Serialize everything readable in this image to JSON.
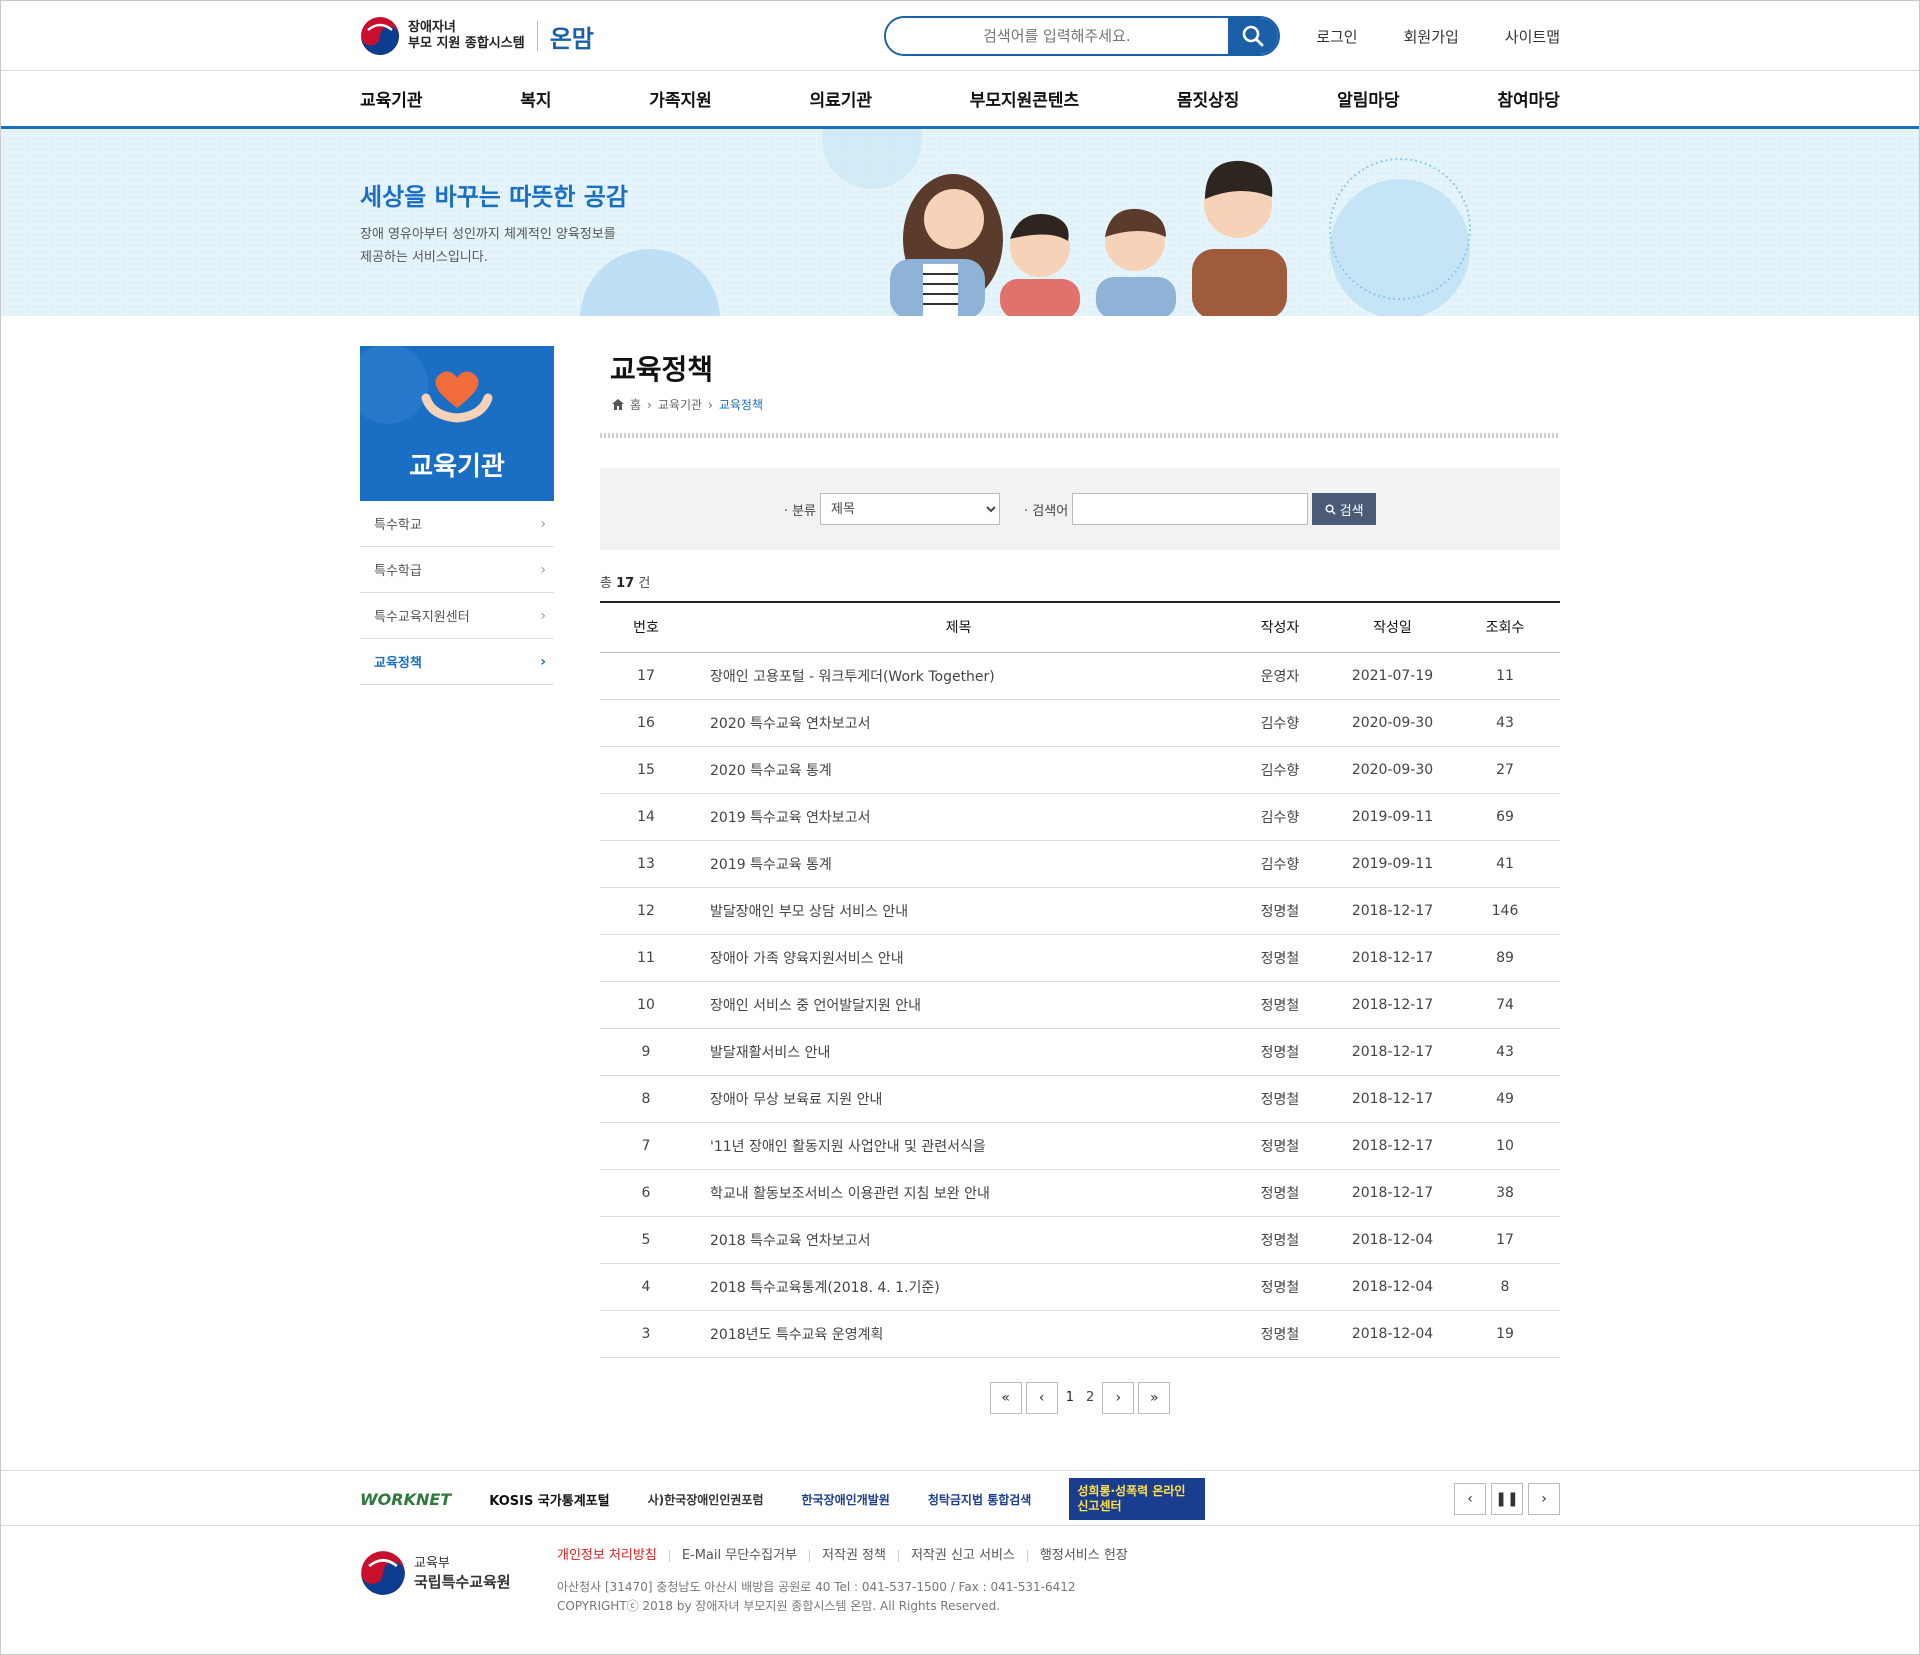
{
  "header": {
    "logo_line1": "장애자녀",
    "logo_line2": "부모 지원 종합시스템",
    "brand": "온맘",
    "search_placeholder": "검색어를 입력해주세요.",
    "util": [
      "로그인",
      "회원가입",
      "사이트맵"
    ]
  },
  "gnb": [
    "교육기관",
    "복지",
    "가족지원",
    "의료기관",
    "부모지원콘텐츠",
    "몸짓상징",
    "알림마당",
    "참여마당"
  ],
  "banner": {
    "title": "세상을 바꾸는 따뜻한 공감",
    "desc": "장애 영유아부터 성인까지 체계적인 양육정보를 제공하는 서비스입니다."
  },
  "lnb": {
    "title": "교육기관",
    "items": [
      "특수학교",
      "특수학급",
      "특수교육지원센터",
      "교육정책"
    ],
    "active_index": 3
  },
  "page": {
    "title": "교육정책",
    "breadcrumb": [
      "홈",
      "교육기관",
      "교육정책"
    ]
  },
  "search_form": {
    "category_label": "· 분류",
    "category_selected": "제목",
    "keyword_label": "· 검색어",
    "button": "검색"
  },
  "total": {
    "prefix": "총",
    "count": "17",
    "suffix": "건"
  },
  "table": {
    "columns": [
      "번호",
      "제목",
      "작성자",
      "작성일",
      "조회수"
    ],
    "rows": [
      [
        "17",
        "장애인 고용포털 - 워크투게더(Work Together)",
        "운영자",
        "2021-07-19",
        "11"
      ],
      [
        "16",
        "2020 특수교육 연차보고서",
        "김수향",
        "2020-09-30",
        "43"
      ],
      [
        "15",
        "2020 특수교육 통계",
        "김수향",
        "2020-09-30",
        "27"
      ],
      [
        "14",
        "2019 특수교육 연차보고서",
        "김수향",
        "2019-09-11",
        "69"
      ],
      [
        "13",
        "2019 특수교육 통계",
        "김수향",
        "2019-09-11",
        "41"
      ],
      [
        "12",
        "발달장애인 부모 상담 서비스 안내",
        "정명철",
        "2018-12-17",
        "146"
      ],
      [
        "11",
        "장애아 가족 양육지원서비스 안내",
        "정명철",
        "2018-12-17",
        "89"
      ],
      [
        "10",
        "장애인 서비스 중 언어발달지원 안내",
        "정명철",
        "2018-12-17",
        "74"
      ],
      [
        "9",
        "발달재활서비스 안내",
        "정명철",
        "2018-12-17",
        "43"
      ],
      [
        "8",
        "장애아 무상 보육료 지원 안내",
        "정명철",
        "2018-12-17",
        "49"
      ],
      [
        "7",
        "'11년 장애인 활동지원 사업안내 및 관련서식을",
        "정명철",
        "2018-12-17",
        "10"
      ],
      [
        "6",
        "학교내 활동보조서비스 이용관련 지침 보완 안내",
        "정명철",
        "2018-12-17",
        "38"
      ],
      [
        "5",
        "2018 특수교육 연차보고서",
        "정명철",
        "2018-12-04",
        "17"
      ],
      [
        "4",
        "2018 특수교육통계(2018. 4. 1.기준)",
        "정명철",
        "2018-12-04",
        "8"
      ],
      [
        "3",
        "2018년도 특수교육 운영계획",
        "정명철",
        "2018-12-04",
        "19"
      ]
    ]
  },
  "pagination": {
    "pages": [
      "1",
      "2"
    ],
    "current": "1"
  },
  "partner_links": [
    "WORKNET",
    "KOSIS 국가통계포털",
    "사)한국장애인인권포럼",
    "한국장애인개발원",
    "청탁금지법 통합검색",
    "성희롱·성폭력 온라인 신고센터"
  ],
  "footer": {
    "org_line1": "교육부",
    "org_line2": "국립특수교육원",
    "menu": [
      "개인정보 처리방침",
      "E-Mail 무단수집거부",
      "저작권 정책",
      "저작권 신고 서비스",
      "행정서비스 헌장"
    ],
    "address": "아산청사 [31470] 충청남도 아산시 배방읍 공원로 40 Tel : 041-537-1500 / Fax : 041-531-6412",
    "copyright": "COPYRIGHTⓒ 2018 by 장애자녀 부모지원 종합시스템 온맘. All Rights Reserved."
  },
  "colors": {
    "primary": "#1a6fc4",
    "brand_dark": "#1a5fa8",
    "banner_bg": "#e5f4fb",
    "search_btn": "#4a5a77"
  }
}
